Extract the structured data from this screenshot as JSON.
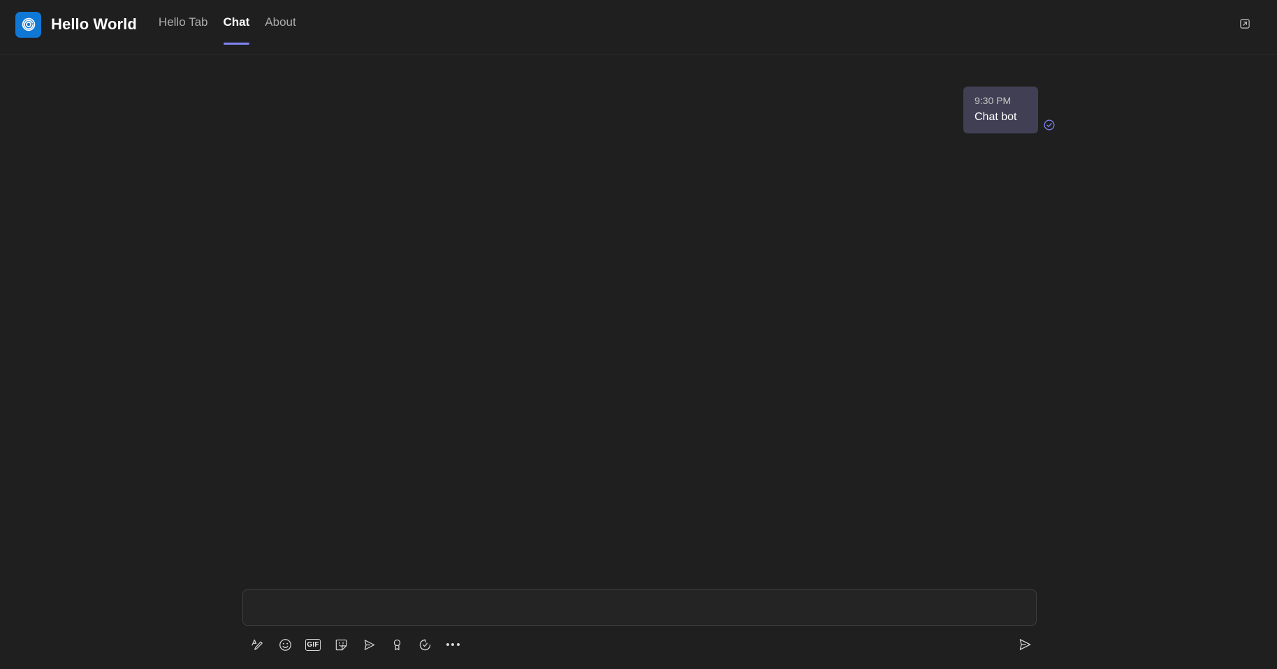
{
  "header": {
    "app_icon_name": "app-logo-spiral-icon",
    "app_title": "Hello World",
    "accent_color": "#7f85f5",
    "icon_bg_color": "#0f78d4",
    "tabs": [
      {
        "label": "Hello Tab",
        "active": false
      },
      {
        "label": "Chat",
        "active": true
      },
      {
        "label": "About",
        "active": false
      }
    ],
    "popout": {
      "label": "Open in new window",
      "icon": "open-in-new-window-icon"
    }
  },
  "conversation": {
    "messages": [
      {
        "time": "9:30 PM",
        "text": "Chat bot",
        "outgoing": true,
        "status_icon": "delivered-check-icon",
        "status_color": "#7f85f5",
        "bubble_color": "#413f54"
      }
    ]
  },
  "compose": {
    "input": {
      "value": "",
      "placeholder": ""
    },
    "tools": [
      {
        "name": "format-icon",
        "label": "Format"
      },
      {
        "name": "emoji-icon",
        "label": "Emoji"
      },
      {
        "name": "gif-icon",
        "label": "GIF",
        "text": "GIF"
      },
      {
        "name": "sticker-icon",
        "label": "Sticker"
      },
      {
        "name": "message-extensions-icon",
        "label": "Message extensions"
      },
      {
        "name": "praise-icon",
        "label": "Praise"
      },
      {
        "name": "loop-components-icon",
        "label": "Loop components"
      },
      {
        "name": "more-options-icon",
        "label": "More options"
      }
    ],
    "send": {
      "name": "send-icon",
      "label": "Send"
    }
  },
  "theme": {
    "background": "#1f1f1f",
    "surface": "#242424",
    "border": "#3d3d3d",
    "text_primary": "#ffffff",
    "text_secondary": "#adadad"
  }
}
